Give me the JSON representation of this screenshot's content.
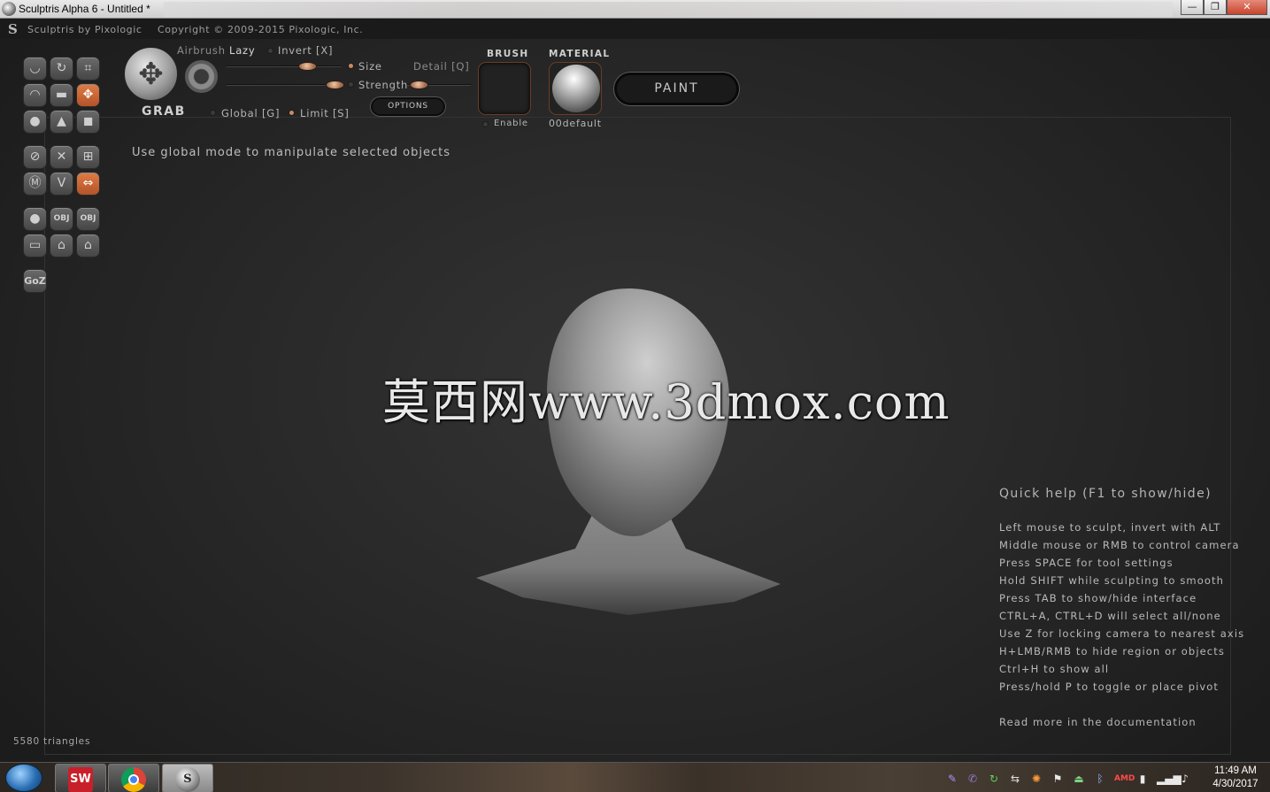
{
  "window": {
    "title": "Sculptris Alpha 6 - Untitled *",
    "min_symbol": "—",
    "max_symbol": "❐",
    "close_symbol": "✕"
  },
  "header": {
    "brand": "Sculptris by Pixologic",
    "copyright": "Copyright © 2009-2015 Pixologic, Inc."
  },
  "toolbar": {
    "tool_name": "GRAB",
    "airbrush_label": "Airbrush",
    "lazy_label": "Lazy",
    "invert_label": "Invert [X]",
    "size_label": "Size",
    "detail_label": "Detail [Q]",
    "strength_label": "Strength",
    "global_label": "Global [G]",
    "limit_label": "Limit [S]",
    "options_label": "OPTIONS",
    "brush_title": "BRUSH",
    "brush_enable_label": "Enable",
    "material_title": "MATERIAL",
    "material_name": "00default",
    "paint_label": "PAINT",
    "size_value": 0.5,
    "strength_value": 0.95,
    "lazy_value": 0.7,
    "accent_color": "#c98a63"
  },
  "hint_text": "Use global mode to manipulate selected objects",
  "tools": {
    "row1": [
      "draw-icon",
      "rotate-icon",
      "crop-icon"
    ],
    "row2": [
      "inflate-icon",
      "flatten-icon",
      "grab-icon"
    ],
    "row3": [
      "pinch-icon",
      "crease-icon",
      "smooth-icon"
    ],
    "row4": [
      "reduce-icon",
      "scale-icon",
      "select-icon"
    ],
    "row5": [
      "mask-icon",
      "symmetry-icon",
      "move-arrows-icon"
    ],
    "row6": [
      "sphere-icon",
      "import-obj-icon",
      "export-obj-icon"
    ],
    "row7": [
      "plane-icon",
      "open-icon",
      "save-icon"
    ],
    "goz_label": "GoZ",
    "obj_label": "OBJ"
  },
  "watermark": "莫西网www.3dmox.com",
  "quick_help": {
    "title": "Quick help (F1 to show/hide)",
    "lines": [
      "Left mouse to sculpt, invert with ALT",
      "Middle mouse or RMB to control camera",
      "Press SPACE for tool settings",
      "Hold SHIFT while sculpting to smooth",
      "Press TAB to show/hide interface",
      "CTRL+A, CTRL+D will select all/none",
      "Use Z for locking camera to nearest axis",
      "H+LMB/RMB to hide region or objects",
      "Ctrl+H to show all",
      "Press/hold P to toggle or place pivot"
    ],
    "more": "Read more in the documentation"
  },
  "status": {
    "triangles": "5580 triangles"
  },
  "taskbar": {
    "apps": [
      "start-button",
      "solidworks-app",
      "chrome-app",
      "sculptris-app"
    ],
    "solidworks_label": "SW",
    "clock_time": "11:49 AM",
    "clock_date": "4/30/2017",
    "tray": [
      "pen-icon",
      "viber-icon",
      "refresh-icon",
      "network-icon",
      "firefox-icon",
      "flag-icon",
      "safely-remove-icon",
      "bluetooth-icon",
      "amd-icon",
      "battery-icon",
      "signal-icon",
      "volume-icon"
    ]
  }
}
